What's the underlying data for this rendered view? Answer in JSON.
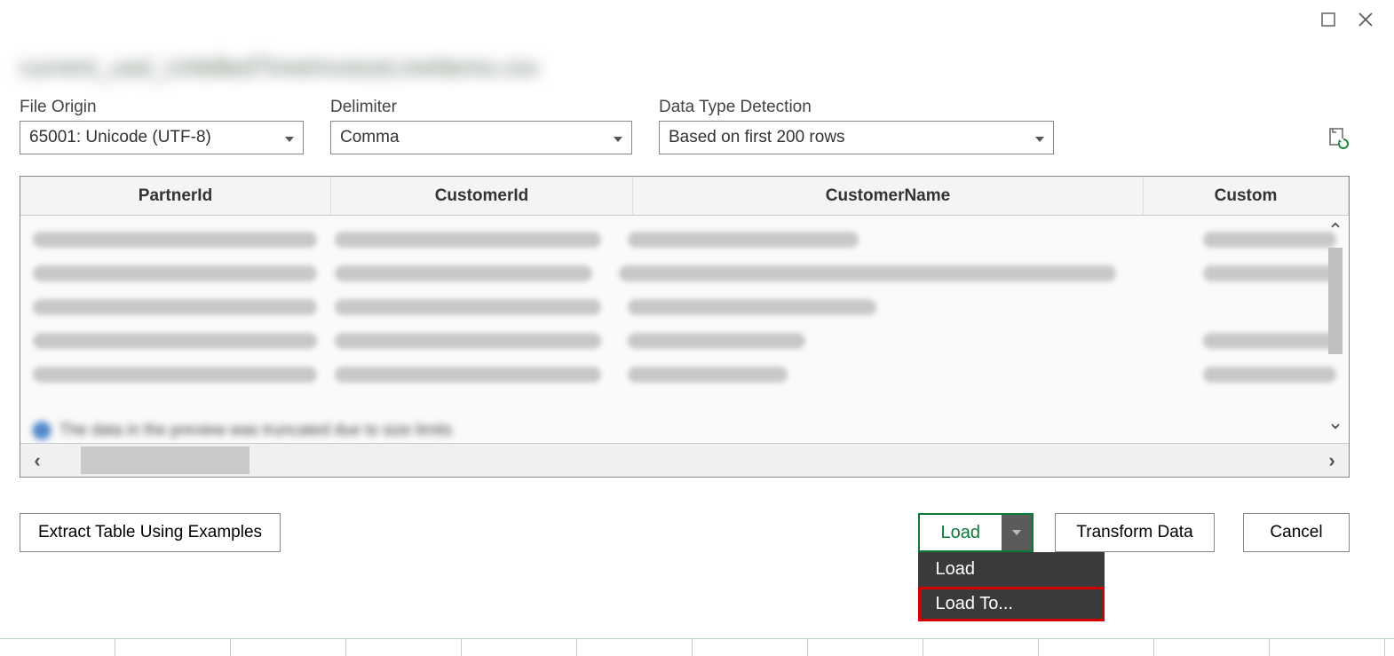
{
  "window": {
    "filename": "current_usd_UnbilledTimeInvoiceLineItems.csv"
  },
  "settings": {
    "fileOrigin": {
      "label": "File Origin",
      "value": "65001: Unicode (UTF-8)"
    },
    "delimiter": {
      "label": "Delimiter",
      "value": "Comma"
    },
    "dataType": {
      "label": "Data Type Detection",
      "value": "Based on first 200 rows"
    }
  },
  "columns": {
    "c1": "PartnerId",
    "c2": "CustomerId",
    "c3": "CustomerName",
    "c4": "Custom"
  },
  "infoText": "The data in the preview was truncated due to size limits",
  "footer": {
    "extract": "Extract Table Using Examples",
    "load": "Load",
    "transform": "Transform Data",
    "cancel": "Cancel",
    "menu": {
      "load": "Load",
      "loadTo": "Load To..."
    }
  }
}
